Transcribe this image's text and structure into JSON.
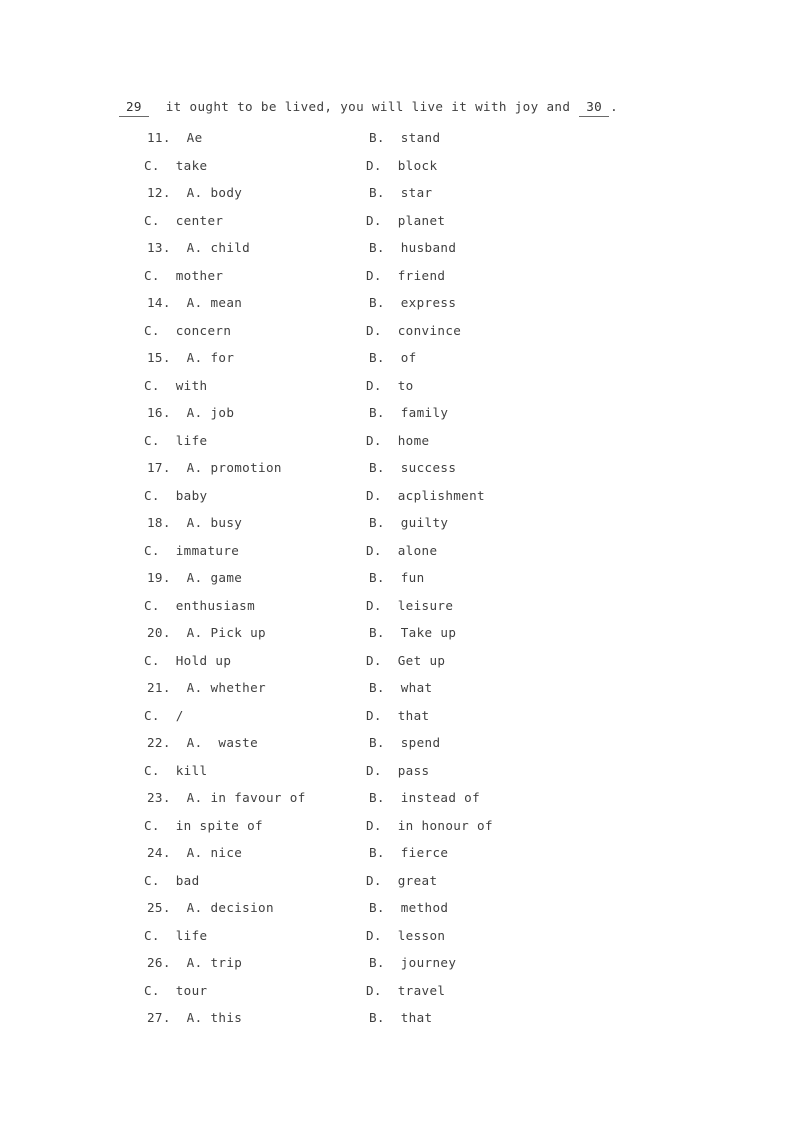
{
  "page": {
    "background_color": "#ffffff",
    "text_color": "#3f3f3f",
    "rule_color": "#6a6a6a"
  },
  "passage": {
    "blank_left": "29",
    "text_middle": "  it ought to be lived, you will live it with joy and ",
    "blank_right": "30",
    "text_end": "."
  },
  "questions": [
    {
      "number": "11.",
      "a": "Ae",
      "b": "B.  stand",
      "c": "C.  take",
      "d": "D.  block"
    },
    {
      "number": "12.",
      "a": "A. body",
      "b": "B.  star",
      "c": "C.  center",
      "d": "D.  planet"
    },
    {
      "number": "13.",
      "a": "A. child",
      "b": "B.  husband",
      "c": "C.  mother",
      "d": "D.  friend"
    },
    {
      "number": "14.",
      "a": "A. mean",
      "b": "B.  express",
      "c": "C.  concern",
      "d": "D.  convince"
    },
    {
      "number": "15.",
      "a": "A. for",
      "b": "B.  of",
      "c": "C.  with",
      "d": "D.  to"
    },
    {
      "number": "16.",
      "a": "A. job",
      "b": "B.  family",
      "c": "C.  life",
      "d": "D.  home"
    },
    {
      "number": "17.",
      "a": "A. promotion",
      "b": "B.  success",
      "c": "C.  baby",
      "d": "D.  acplishment"
    },
    {
      "number": "18.",
      "a": "A. busy",
      "b": "B.  guilty",
      "c": "C.  immature",
      "d": "D.  alone"
    },
    {
      "number": "19.",
      "a": "A. game",
      "b": "B.  fun",
      "c": "C.  enthusiasm",
      "d": "D.  leisure"
    },
    {
      "number": "20.",
      "a": "A. Pick up",
      "b": "B.  Take up",
      "c": "C.  Hold up",
      "d": "D.  Get up"
    },
    {
      "number": "21.",
      "a": "A. whether",
      "b": "B.  what",
      "c": "C.  /",
      "d": "D.  that"
    },
    {
      "number": "22.",
      "a": "A.  waste",
      "b": "B.  spend",
      "c": "C.  kill",
      "d": "D.  pass"
    },
    {
      "number": "23.",
      "a": "A. in favour of",
      "b": "B.  instead of",
      "c": "C.  in spite of",
      "d": "D.  in honour of"
    },
    {
      "number": "24.",
      "a": "A. nice",
      "b": "B.  fierce",
      "c": "C.  bad",
      "d": "D.  great"
    },
    {
      "number": "25.",
      "a": "A. decision",
      "b": "B.  method",
      "c": "C.  life",
      "d": "D.  lesson"
    },
    {
      "number": "26.",
      "a": "A. trip",
      "b": "B.  journey",
      "c": "C.  tour",
      "d": "D.  travel"
    },
    {
      "number": "27.",
      "a": "A. this",
      "b": "B.  that",
      "c": null,
      "d": null
    }
  ]
}
